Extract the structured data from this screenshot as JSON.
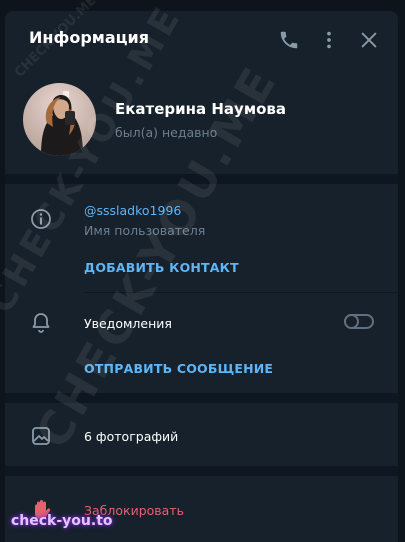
{
  "header": {
    "title": "Информация",
    "icons": [
      "phone-icon",
      "more-vertical-icon",
      "close-icon"
    ]
  },
  "profile": {
    "name": "Екатерина Наумова",
    "status": "был(а) недавно"
  },
  "info": {
    "username": "@sssladko1996",
    "username_label": "Имя пользователя",
    "add_contact": "ДОБАВИТЬ КОНТАКТ"
  },
  "notifications": {
    "label": "Уведомления",
    "enabled": false,
    "send_message": "ОТПРАВИТЬ СООБЩЕНИЕ"
  },
  "media": {
    "photos_label": "6 фотографий"
  },
  "block": {
    "label": "Заблокировать"
  },
  "watermark": {
    "text": "CHECK-YOU.ME",
    "footer": "check-you.to"
  },
  "colors": {
    "panel": "#17212b",
    "accent": "#5eb5f7",
    "danger": "#e5616e",
    "muted": "#6d7f8f"
  }
}
